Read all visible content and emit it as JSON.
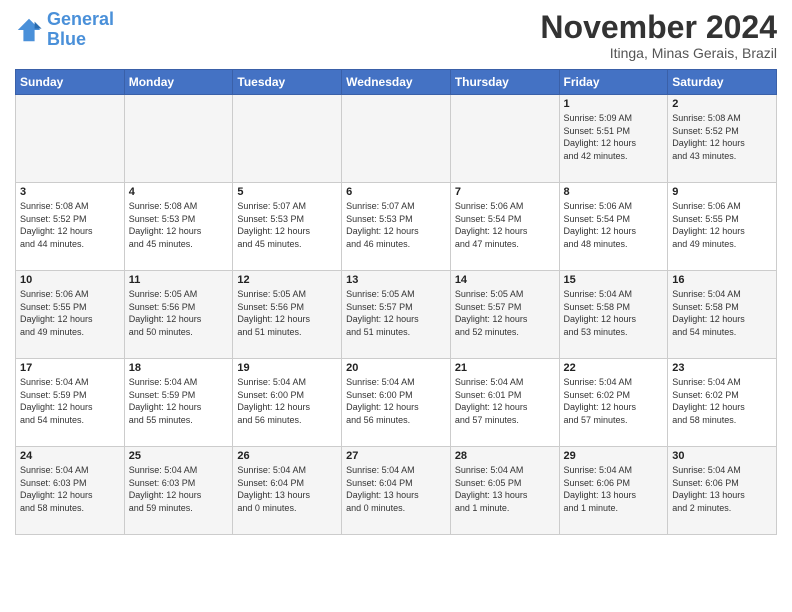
{
  "header": {
    "logo_general": "General",
    "logo_blue": "Blue",
    "month": "November 2024",
    "location": "Itinga, Minas Gerais, Brazil"
  },
  "days_of_week": [
    "Sunday",
    "Monday",
    "Tuesday",
    "Wednesday",
    "Thursday",
    "Friday",
    "Saturday"
  ],
  "weeks": [
    [
      {
        "day": "",
        "info": ""
      },
      {
        "day": "",
        "info": ""
      },
      {
        "day": "",
        "info": ""
      },
      {
        "day": "",
        "info": ""
      },
      {
        "day": "",
        "info": ""
      },
      {
        "day": "1",
        "info": "Sunrise: 5:09 AM\nSunset: 5:51 PM\nDaylight: 12 hours\nand 42 minutes."
      },
      {
        "day": "2",
        "info": "Sunrise: 5:08 AM\nSunset: 5:52 PM\nDaylight: 12 hours\nand 43 minutes."
      }
    ],
    [
      {
        "day": "3",
        "info": "Sunrise: 5:08 AM\nSunset: 5:52 PM\nDaylight: 12 hours\nand 44 minutes."
      },
      {
        "day": "4",
        "info": "Sunrise: 5:08 AM\nSunset: 5:53 PM\nDaylight: 12 hours\nand 45 minutes."
      },
      {
        "day": "5",
        "info": "Sunrise: 5:07 AM\nSunset: 5:53 PM\nDaylight: 12 hours\nand 45 minutes."
      },
      {
        "day": "6",
        "info": "Sunrise: 5:07 AM\nSunset: 5:53 PM\nDaylight: 12 hours\nand 46 minutes."
      },
      {
        "day": "7",
        "info": "Sunrise: 5:06 AM\nSunset: 5:54 PM\nDaylight: 12 hours\nand 47 minutes."
      },
      {
        "day": "8",
        "info": "Sunrise: 5:06 AM\nSunset: 5:54 PM\nDaylight: 12 hours\nand 48 minutes."
      },
      {
        "day": "9",
        "info": "Sunrise: 5:06 AM\nSunset: 5:55 PM\nDaylight: 12 hours\nand 49 minutes."
      }
    ],
    [
      {
        "day": "10",
        "info": "Sunrise: 5:06 AM\nSunset: 5:55 PM\nDaylight: 12 hours\nand 49 minutes."
      },
      {
        "day": "11",
        "info": "Sunrise: 5:05 AM\nSunset: 5:56 PM\nDaylight: 12 hours\nand 50 minutes."
      },
      {
        "day": "12",
        "info": "Sunrise: 5:05 AM\nSunset: 5:56 PM\nDaylight: 12 hours\nand 51 minutes."
      },
      {
        "day": "13",
        "info": "Sunrise: 5:05 AM\nSunset: 5:57 PM\nDaylight: 12 hours\nand 51 minutes."
      },
      {
        "day": "14",
        "info": "Sunrise: 5:05 AM\nSunset: 5:57 PM\nDaylight: 12 hours\nand 52 minutes."
      },
      {
        "day": "15",
        "info": "Sunrise: 5:04 AM\nSunset: 5:58 PM\nDaylight: 12 hours\nand 53 minutes."
      },
      {
        "day": "16",
        "info": "Sunrise: 5:04 AM\nSunset: 5:58 PM\nDaylight: 12 hours\nand 54 minutes."
      }
    ],
    [
      {
        "day": "17",
        "info": "Sunrise: 5:04 AM\nSunset: 5:59 PM\nDaylight: 12 hours\nand 54 minutes."
      },
      {
        "day": "18",
        "info": "Sunrise: 5:04 AM\nSunset: 5:59 PM\nDaylight: 12 hours\nand 55 minutes."
      },
      {
        "day": "19",
        "info": "Sunrise: 5:04 AM\nSunset: 6:00 PM\nDaylight: 12 hours\nand 56 minutes."
      },
      {
        "day": "20",
        "info": "Sunrise: 5:04 AM\nSunset: 6:00 PM\nDaylight: 12 hours\nand 56 minutes."
      },
      {
        "day": "21",
        "info": "Sunrise: 5:04 AM\nSunset: 6:01 PM\nDaylight: 12 hours\nand 57 minutes."
      },
      {
        "day": "22",
        "info": "Sunrise: 5:04 AM\nSunset: 6:02 PM\nDaylight: 12 hours\nand 57 minutes."
      },
      {
        "day": "23",
        "info": "Sunrise: 5:04 AM\nSunset: 6:02 PM\nDaylight: 12 hours\nand 58 minutes."
      }
    ],
    [
      {
        "day": "24",
        "info": "Sunrise: 5:04 AM\nSunset: 6:03 PM\nDaylight: 12 hours\nand 58 minutes."
      },
      {
        "day": "25",
        "info": "Sunrise: 5:04 AM\nSunset: 6:03 PM\nDaylight: 12 hours\nand 59 minutes."
      },
      {
        "day": "26",
        "info": "Sunrise: 5:04 AM\nSunset: 6:04 PM\nDaylight: 13 hours\nand 0 minutes."
      },
      {
        "day": "27",
        "info": "Sunrise: 5:04 AM\nSunset: 6:04 PM\nDaylight: 13 hours\nand 0 minutes."
      },
      {
        "day": "28",
        "info": "Sunrise: 5:04 AM\nSunset: 6:05 PM\nDaylight: 13 hours\nand 1 minute."
      },
      {
        "day": "29",
        "info": "Sunrise: 5:04 AM\nSunset: 6:06 PM\nDaylight: 13 hours\nand 1 minute."
      },
      {
        "day": "30",
        "info": "Sunrise: 5:04 AM\nSunset: 6:06 PM\nDaylight: 13 hours\nand 2 minutes."
      }
    ]
  ]
}
